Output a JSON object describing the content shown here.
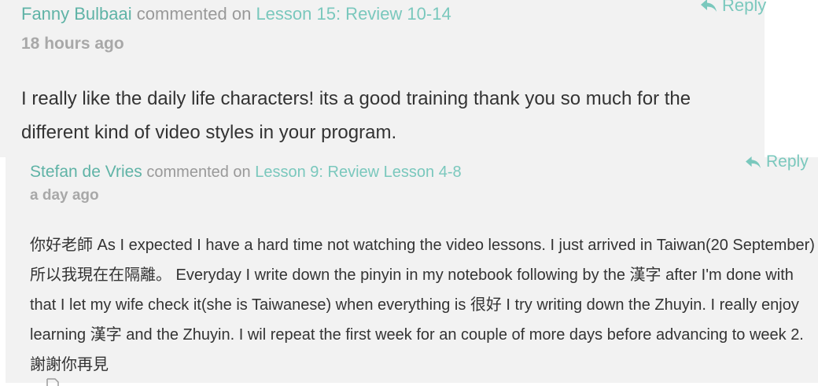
{
  "comments": [
    {
      "author": "Fanny Bulbaai",
      "action": "commented on",
      "lesson": "Lesson 15: Review 10-14",
      "time": "18 hours ago",
      "reply_label": "Reply",
      "body": "I really like the daily life characters! its a good training thank you so much for the different kind of video styles in your program."
    },
    {
      "author": "Stefan de Vries",
      "action": "commented on",
      "lesson": "Lesson 9: Review Lesson 4-8",
      "time": "a day ago",
      "reply_label": "Reply",
      "body": "你好老師 As I expected I have a hard time not watching the video lessons. I just arrived in Taiwan(20 September) 所以我現在在隔離。 Everyday I write down the pinyin in my notebook following by the 漢字 after I'm done with that I let my wife check it(she is Taiwanese) when everything is 很好 I try writing down the Zhuyin. I really enjoy learning 漢字 and the Zhuyin. I wil repeat the first week for an couple of more days before advancing to week 2. 謝謝你再見"
    }
  ],
  "icons": {
    "reply": "reply-arrow-icon",
    "attachment": "document-icon"
  },
  "colors": {
    "accent": "#5fb3a6",
    "link": "#7ac8bd",
    "muted": "#999999",
    "card_bg": "#f2f2f2"
  }
}
